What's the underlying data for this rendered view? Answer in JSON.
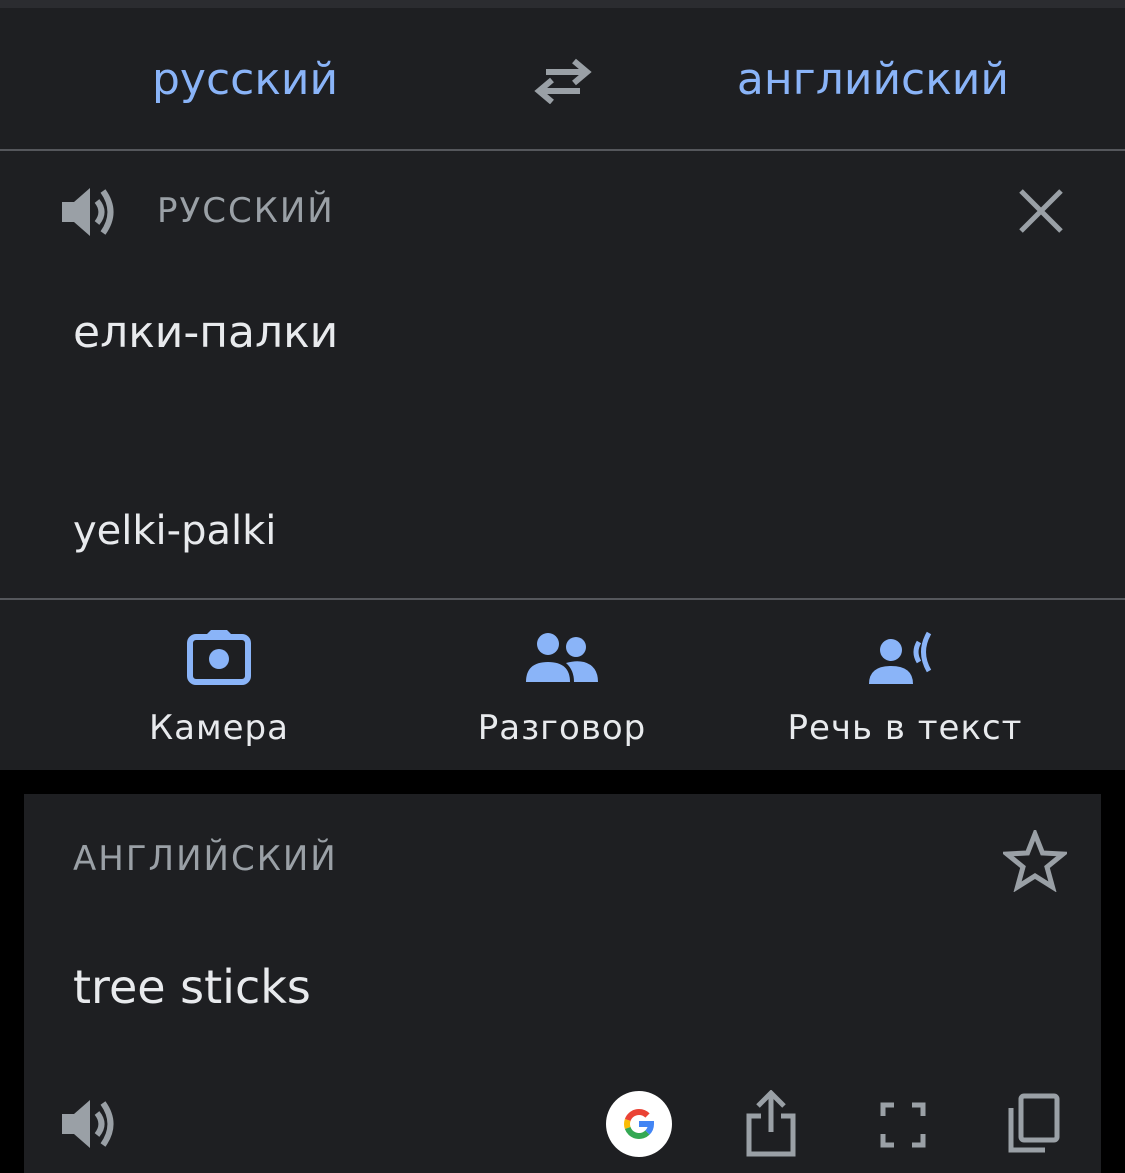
{
  "header": {
    "source_language": "русский",
    "target_language": "английский"
  },
  "input": {
    "language_label": "РУССКИЙ",
    "text": "елки-палки",
    "transliteration": "yelki-palki"
  },
  "tools": [
    {
      "label": "Камера",
      "icon": "camera-icon"
    },
    {
      "label": "Разговор",
      "icon": "people-icon"
    },
    {
      "label": "Речь в текст",
      "icon": "voice-icon"
    }
  ],
  "result": {
    "language_label": "АНГЛИЙСКИЙ",
    "text": "tree sticks"
  },
  "colors": {
    "accent": "#8ab4f8",
    "background": "#000000",
    "panel": "#1e1f22",
    "icon_gray": "#9aa0a6"
  }
}
